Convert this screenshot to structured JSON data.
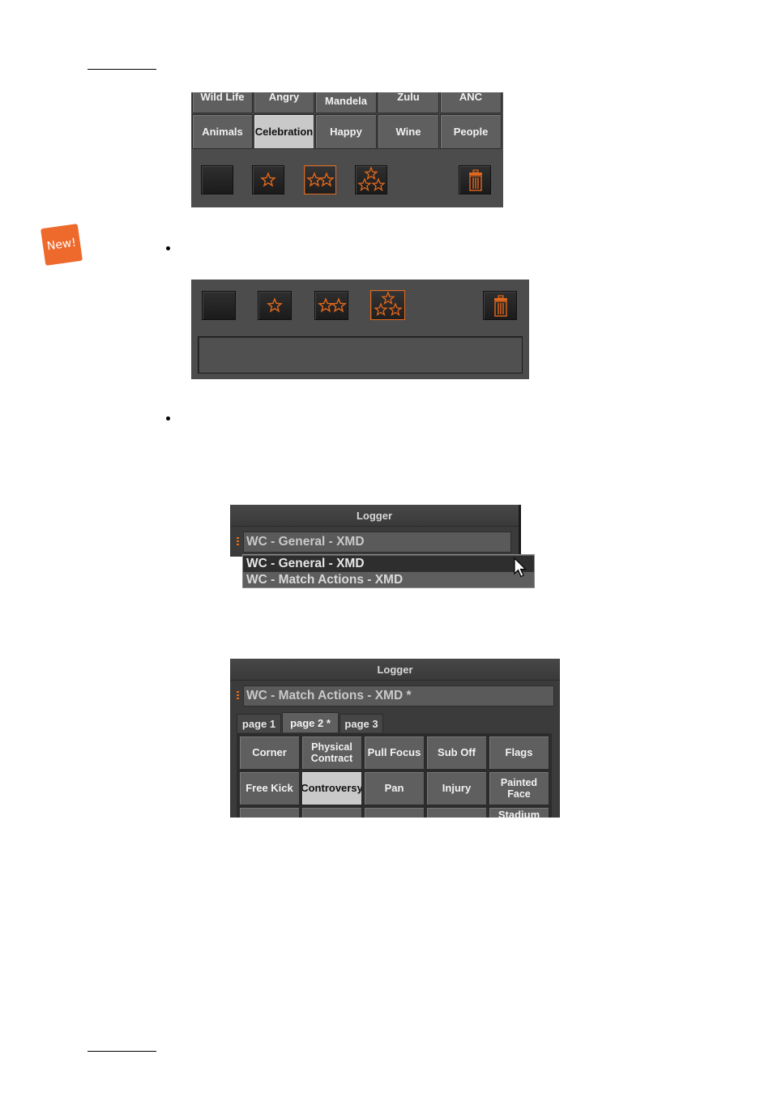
{
  "colors": {
    "accent": "#e4681b",
    "panel": "#4c4c4c",
    "button": "#5f5f5f",
    "selected": "#c9c9c9"
  },
  "badge": {
    "text": "New!"
  },
  "figure1": {
    "rows": [
      [
        "Wild Life",
        "Angry",
        "Mandela",
        "Zulu",
        "ANC"
      ],
      [
        "Animals",
        "Celebration",
        "Happy",
        "Wine",
        "People"
      ]
    ],
    "selected": "Celebration",
    "rating_buttons": [
      "no-star",
      "one-star",
      "two-star",
      "three-star",
      "delete"
    ],
    "active_rating": "two-star"
  },
  "figure2": {
    "rating_buttons": [
      "no-star",
      "one-star",
      "two-star",
      "three-star",
      "delete"
    ],
    "active_rating": "three-star",
    "comment_text": ""
  },
  "logger1": {
    "title": "Logger",
    "selected_value": "WC - General - XMD",
    "options": [
      "WC - General - XMD",
      "WC - Match Actions - XMD"
    ],
    "highlighted_option": "WC - General - XMD"
  },
  "logger2": {
    "title": "Logger",
    "selected_value": "WC - Match Actions - XMD *",
    "tabs": [
      "page 1",
      "page 2 *",
      "page 3"
    ],
    "active_tab": "page 2 *",
    "grid": [
      [
        "Corner",
        "Physical Contract",
        "Pull Focus",
        "Sub Off",
        "Flags"
      ],
      [
        "Free Kick",
        "Controversy",
        "Pan",
        "Injury",
        "Painted Face"
      ],
      [
        "",
        "",
        "",
        "",
        "Stadium"
      ]
    ],
    "selected": "Controversy"
  }
}
